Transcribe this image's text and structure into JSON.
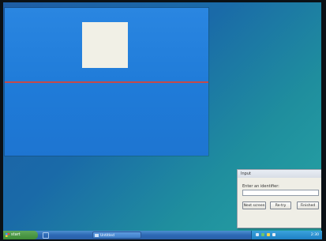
{
  "dialog": {
    "title": "Input",
    "label": "Enter an identifier:",
    "input_value": "",
    "buttons": [
      "Next screen",
      "Re-try",
      "Finished"
    ]
  },
  "taskbar": {
    "start_label": "start",
    "task_label": "Untitled",
    "clock": "2:30"
  }
}
